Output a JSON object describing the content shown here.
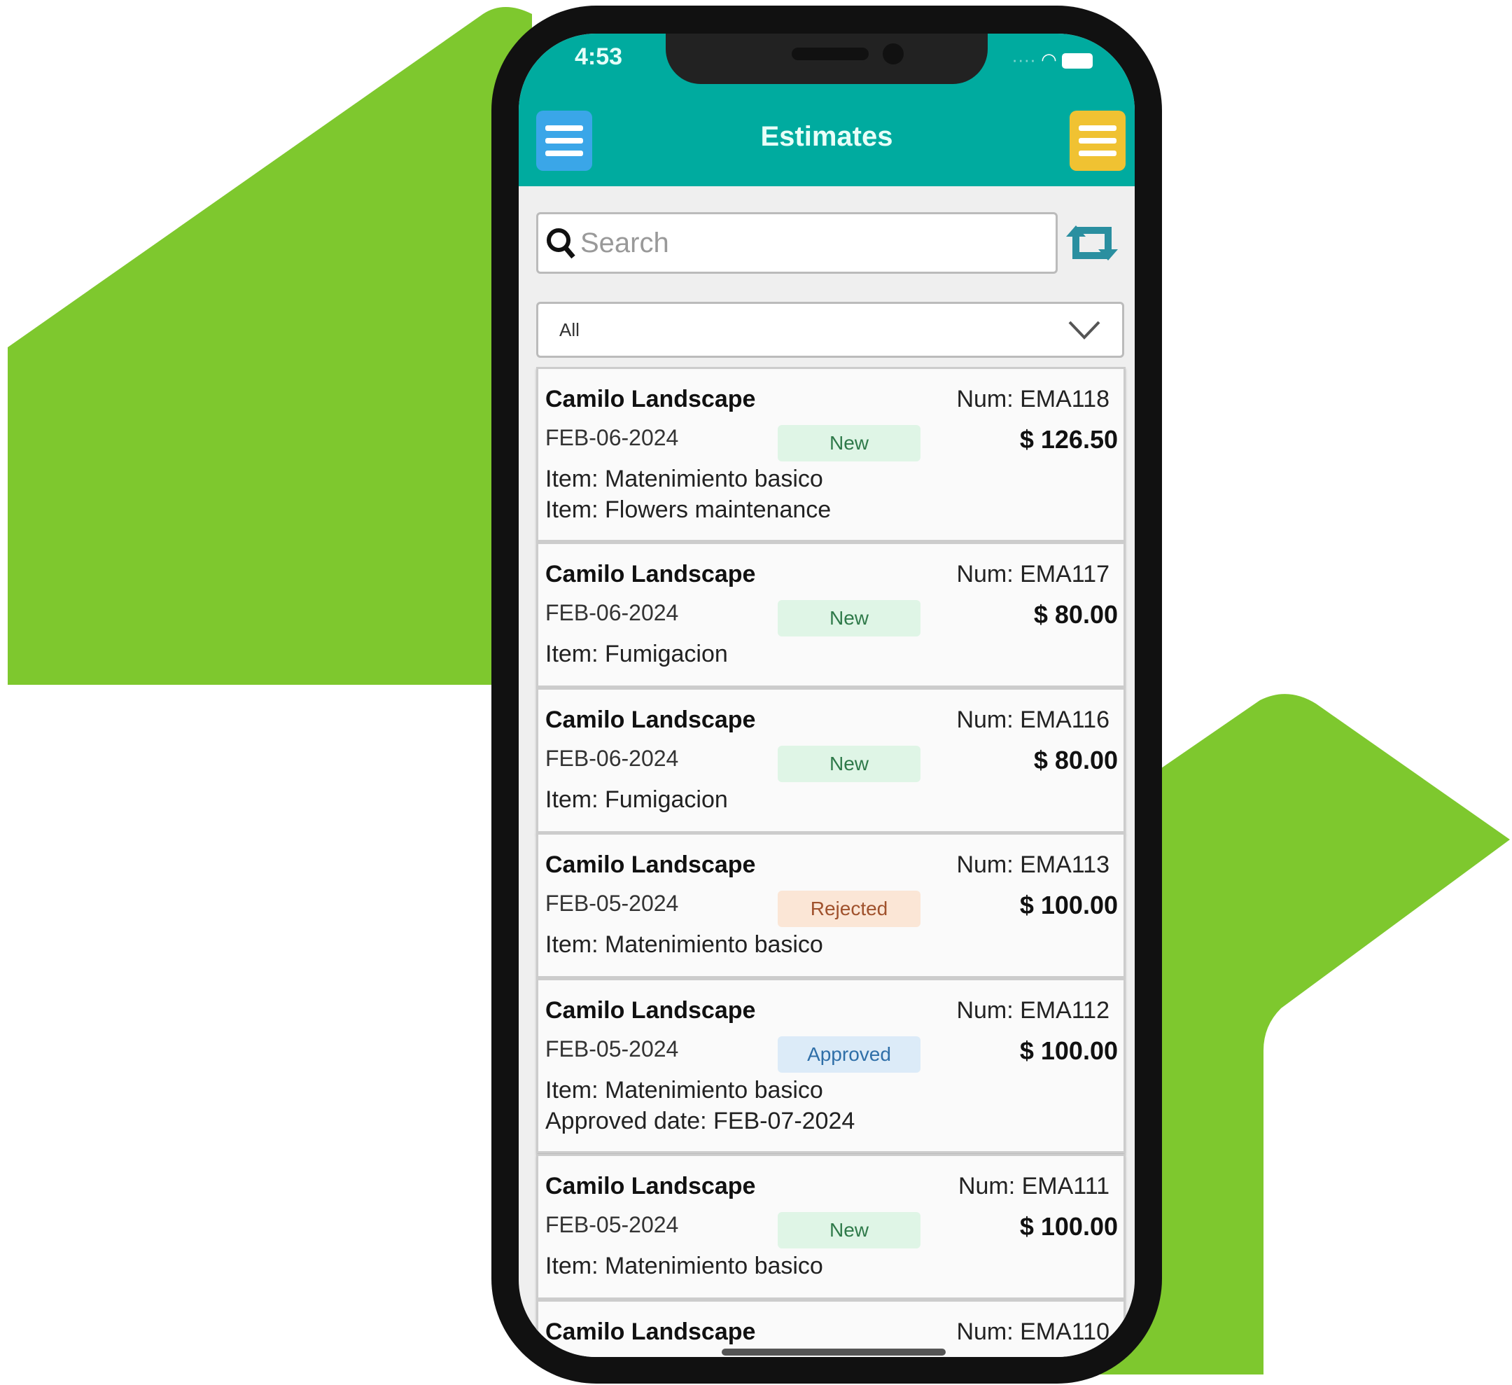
{
  "colors": {
    "brand_teal": "#00ab9f",
    "background_green": "#7ec82e",
    "left_menu": "#3aa6e8",
    "right_menu": "#f0c232",
    "new_badge": "#dff5e6",
    "rejected_badge": "#fbe6d6",
    "approved_badge": "#dcebf8"
  },
  "status_bar": {
    "time": "4:53",
    "icons": [
      "signal-icon",
      "wifi-icon",
      "battery-icon"
    ]
  },
  "header": {
    "title": "Estimates",
    "left_icon": "hamburger-menu-icon",
    "right_icon": "hamburger-menu-icon"
  },
  "search": {
    "placeholder": "Search",
    "icon": "search-icon",
    "refresh_icon": "refresh-icon"
  },
  "filter": {
    "selected": "All",
    "icon": "chevron-down-icon"
  },
  "estimates": [
    {
      "name": "Camilo Landscape",
      "num": "Num: EMA118",
      "date": "FEB-06-2024",
      "status": "New",
      "amount": "$ 126.50",
      "lines": [
        "Item: Matenimiento basico",
        "Item: Flowers maintenance"
      ]
    },
    {
      "name": "Camilo Landscape",
      "num": "Num: EMA117",
      "date": "FEB-06-2024",
      "status": "New",
      "amount": "$ 80.00",
      "lines": [
        "Item: Fumigacion"
      ]
    },
    {
      "name": "Camilo Landscape",
      "num": "Num: EMA116",
      "date": "FEB-06-2024",
      "status": "New",
      "amount": "$ 80.00",
      "lines": [
        "Item: Fumigacion"
      ]
    },
    {
      "name": "Camilo Landscape",
      "num": "Num: EMA113",
      "date": "FEB-05-2024",
      "status": "Rejected",
      "amount": "$ 100.00",
      "lines": [
        "Item: Matenimiento basico"
      ]
    },
    {
      "name": "Camilo Landscape",
      "num": "Num: EMA112",
      "date": "FEB-05-2024",
      "status": "Approved",
      "amount": "$ 100.00",
      "lines": [
        "Item: Matenimiento basico",
        "Approved date: FEB-07-2024"
      ]
    },
    {
      "name": "Camilo Landscape",
      "num": "Num: EMA111",
      "date": "FEB-05-2024",
      "status": "New",
      "amount": "$ 100.00",
      "lines": [
        "Item: Matenimiento basico"
      ]
    },
    {
      "name": "Camilo Landscape",
      "num": "Num: EMA110"
    }
  ]
}
